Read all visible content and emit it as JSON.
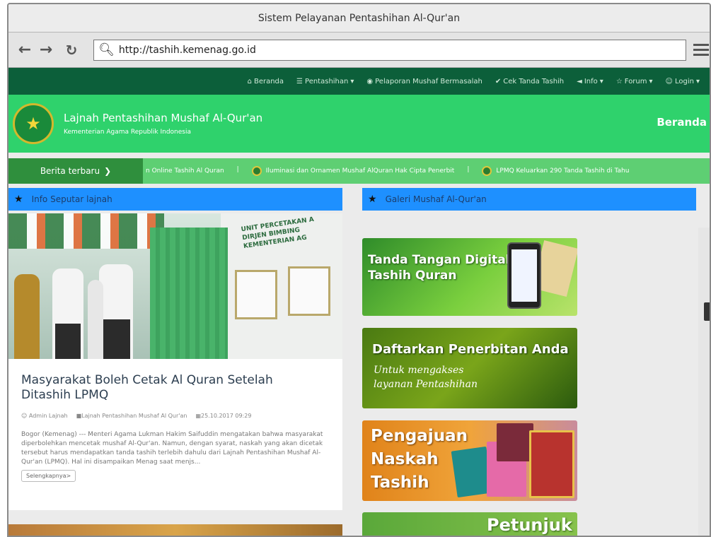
{
  "window": {
    "title": "Sistem Pelayanan Pentashihan Al-Qur'an"
  },
  "toolbar": {
    "back_icon": "back-arrow-icon",
    "forward_icon": "forward-arrow-icon",
    "reload_icon": "reload-icon",
    "url": "http://tashih.kemenag.go.id"
  },
  "topnav": {
    "items": [
      {
        "label": "Beranda",
        "icon": "home-icon"
      },
      {
        "label": "Pentashihan",
        "icon": "list-icon"
      },
      {
        "label": "Pelaporan Mushaf Bermasalah",
        "icon": "eye-icon"
      },
      {
        "label": "Cek Tanda Tashih",
        "icon": "check-icon"
      },
      {
        "label": "Info",
        "icon": "megaphone-icon"
      },
      {
        "label": "Forum",
        "icon": "forum-icon"
      },
      {
        "label": "Login",
        "icon": "user-icon"
      }
    ]
  },
  "header": {
    "title": "Lajnah Pentashihan Mushaf Al-Qur'an",
    "subtitle": "Kementerian Agama Republik Indonesia",
    "right_link": "Beranda"
  },
  "ticker": {
    "label": "Berita terbaru",
    "items": [
      "n Online Tashih Al Quran",
      "Iluminasi dan Ornamen Mushaf AlQuran Hak Cipta Penerbit",
      "LPMQ Keluarkan 290 Tanda Tashih di Tahu"
    ]
  },
  "sections": {
    "left": "Info Seputar lajnah",
    "right": "Galeri Mushaf Al-Qur'an"
  },
  "article": {
    "photo_text": "UNIT PERCETAKAN A\nDIRJEN BIMBING\nKEMENTERIAN AG",
    "title": "Masyarakat Boleh Cetak Al Quran Setelah Ditashih LPMQ",
    "author": "Admin Lajnah",
    "category": "Lajnah Pentashihan Mushaf Al Qur'an",
    "date": "25.10.2017 09:29",
    "excerpt": "Bogor (Kemenag) --- Menteri Agama Lukman Hakim Saifuddin mengatakan bahwa masyarakat diperbolehkan mencetak mushaf Al-Qur'an. Namun, dengan syarat, naskah yang akan dicetak tersebut harus mendapatkan tanda tashih terlebih dahulu dari Lajnah Pentashihan Mushaf Al-Qur'an (LPMQ). Hal ini disampaikan Menag saat menjs...",
    "more_label": "Selengkapnya>"
  },
  "banners": {
    "b1": "Tanda Tangan Digital\nTashih Quran",
    "b2_title": "Daftarkan Penerbitan Anda",
    "b2_sub": "Untuk mengakses\nlayanan Pentashihan",
    "b3": "Pengajuan\nNaskah\nTashih",
    "b4": "Petunjuk"
  },
  "colors": {
    "nav_dark": "#0c5f3a",
    "header_green": "#2fd26c",
    "section_blue": "#1e90ff"
  }
}
